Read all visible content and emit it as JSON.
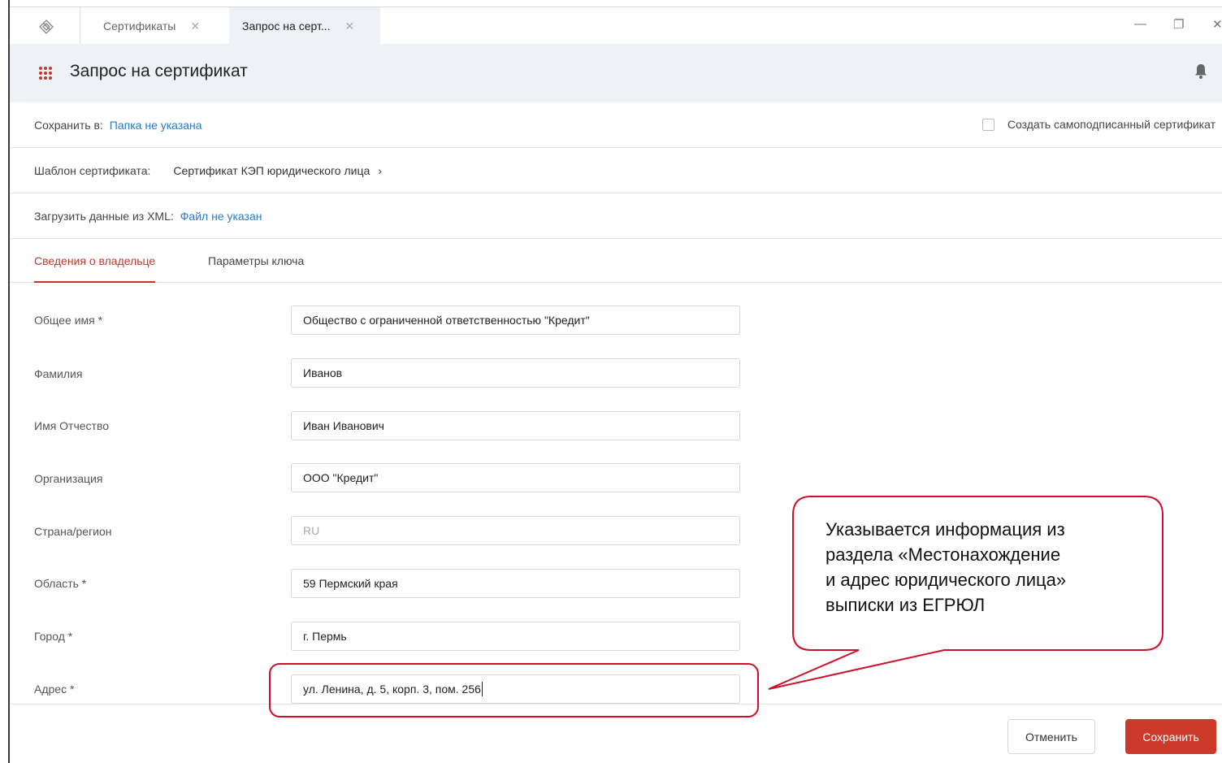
{
  "tabs": [
    {
      "label": "Сертификаты"
    },
    {
      "label": "Запрос на серт..."
    }
  ],
  "window": {
    "minimize": "—",
    "restore": "❐",
    "close": "✕"
  },
  "header": {
    "title": "Запрос на сертификат"
  },
  "save_row": {
    "label": "Сохранить в:",
    "value": "Папка не указана"
  },
  "self_signed": {
    "label": "Создать самоподписанный сертификат",
    "checked": false
  },
  "template_row": {
    "label": "Шаблон сертификата:",
    "value": "Сертификат КЭП юридического лица"
  },
  "xml_row": {
    "label": "Загрузить данные из XML:",
    "value": "Файл не указан"
  },
  "inner_tabs": [
    {
      "label": "Сведения о владельце",
      "active": true
    },
    {
      "label": "Параметры ключа",
      "active": false
    }
  ],
  "fields": [
    {
      "label": "Общее имя *",
      "value": "Общество с ограниченной ответственностью \"Кредит\""
    },
    {
      "label": "Фамилия",
      "value": "Иванов"
    },
    {
      "label": "Имя Отчество",
      "value": "Иван Иванович"
    },
    {
      "label": "Организация",
      "value": "ООО \"Кредит\""
    },
    {
      "label": "Страна/регион",
      "value": "RU",
      "disabled": true
    },
    {
      "label": "Область *",
      "value": "59 Пермский края"
    },
    {
      "label": "Город *",
      "value": "г. Пермь"
    },
    {
      "label": "Адрес *",
      "value": "ул. Ленина, д. 5, корп. 3, пом. 256"
    }
  ],
  "buttons": {
    "cancel": "Отменить",
    "save": "Сохранить"
  },
  "annotation": {
    "text": "Указывается информация из\nраздела  «Местонахождение\n и адрес юридического лица»\nвыписки из ЕГРЮЛ",
    "color": "#d0102a"
  },
  "colors": {
    "accent": "#c0392b",
    "link": "#2f78c4",
    "header_bg": "#eef1f6"
  }
}
